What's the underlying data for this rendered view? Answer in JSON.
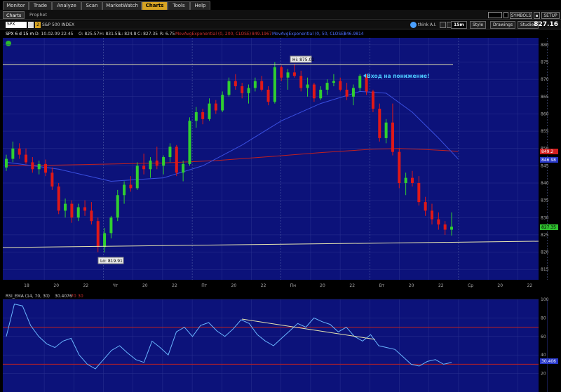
{
  "menu": {
    "tabs": [
      {
        "label": "Monitor",
        "active": false
      },
      {
        "label": "Trade",
        "active": false
      },
      {
        "label": "Analyze",
        "active": false
      },
      {
        "label": "Scan",
        "active": false
      },
      {
        "label": "MarketWatch",
        "active": false
      },
      {
        "label": "Charts",
        "active": true
      },
      {
        "label": "Tools",
        "active": false
      },
      {
        "label": "Help",
        "active": false
      }
    ]
  },
  "subtabs": {
    "charts": "Charts",
    "prophet": "Prophet"
  },
  "top_right": {
    "symbols": "SYMBOLS",
    "setup": "SETUP"
  },
  "symbol_bar": {
    "symbol": "SPX",
    "link_number": "2",
    "description": "S&P 500 INDEX",
    "thinkai": "think A.I.",
    "timeframe": "15m",
    "style": "Style",
    "drawings": "Drawings",
    "studies": "Studies",
    "last": "827.16"
  },
  "chart": {
    "header": {
      "title": "SPX 6 d 15 m",
      "date": "D: 10.02.09 22:45",
      "open": "O: 825.57",
      "high": "H: 831.55",
      "low": "L: 824.8",
      "close": "C: 827.35",
      "range": "R: 6.75",
      "ema200_label": "MovAvgExponential (0, 200, CLOSE)",
      "ema200_value": "849.1967",
      "ema50_label": "MovAvgExponential (0, 50, CLOSE)",
      "ema50_value": "846.9814"
    },
    "price_axis_ticks": [
      "880",
      "875",
      "870",
      "865",
      "860",
      "855",
      "850",
      "845",
      "840",
      "835",
      "830",
      "825",
      "820",
      "815"
    ],
    "time_axis_labels": [
      "18",
      "20",
      "22",
      "Чт",
      "20",
      "22",
      "Пт",
      "20",
      "22",
      "Пн",
      "20",
      "22",
      "Вт",
      "20",
      "22",
      "Ср",
      "20",
      "22"
    ],
    "high_label": "Hi: 875.01",
    "low_label": "Lo: 819.91",
    "annotation": "Вход на понижение!",
    "price_tags": {
      "ema200": "849.2",
      "ema50": "846.98",
      "last": "827.35"
    }
  },
  "rsi": {
    "label": "RSI_EMA (14, 70, 30)",
    "value": "30.4076",
    "overbought": "70",
    "oversold": "30",
    "axis_ticks": [
      "100",
      "80",
      "60",
      "40",
      "20"
    ],
    "value_tag": "30.406"
  },
  "chart_data": {
    "type": "candlestick",
    "symbol": "SPX",
    "interval": "15m",
    "ylim": [
      812,
      882
    ],
    "candles": [
      [
        844.5,
        848.2,
        843.5,
        847.0
      ],
      [
        847.0,
        852.0,
        846.0,
        850.0
      ],
      [
        850.0,
        851.5,
        847.0,
        848.2
      ],
      [
        848.2,
        850.0,
        845.5,
        846.0
      ],
      [
        846.0,
        847.5,
        843.0,
        844.0
      ],
      [
        844.0,
        846.5,
        842.5,
        845.5
      ],
      [
        845.5,
        846.8,
        842.0,
        843.0
      ],
      [
        843.0,
        844.5,
        838.0,
        839.0
      ],
      [
        839.0,
        840.0,
        831.0,
        832.0
      ],
      [
        832.0,
        835.5,
        830.0,
        834.0
      ],
      [
        834.0,
        835.0,
        828.5,
        830.0
      ],
      [
        830.0,
        834.0,
        829.0,
        833.0
      ],
      [
        833.0,
        835.0,
        830.5,
        832.0
      ],
      [
        832.0,
        834.5,
        828.0,
        829.0
      ],
      [
        829.0,
        830.0,
        820.0,
        821.5
      ],
      [
        821.5,
        827.0,
        819.9,
        825.5
      ],
      [
        825.5,
        830.5,
        824.0,
        830.0
      ],
      [
        830.0,
        838.0,
        829.0,
        836.5
      ],
      [
        836.5,
        840.5,
        834.0,
        839.5
      ],
      [
        839.5,
        842.0,
        837.5,
        838.5
      ],
      [
        838.5,
        846.0,
        838.0,
        845.0
      ],
      [
        845.0,
        848.5,
        842.5,
        844.0
      ],
      [
        844.0,
        847.5,
        841.5,
        846.5
      ],
      [
        846.5,
        850.5,
        844.0,
        845.0
      ],
      [
        845.0,
        848.0,
        842.5,
        847.5
      ],
      [
        847.5,
        851.5,
        846.0,
        850.5
      ],
      [
        850.5,
        851.0,
        842.0,
        843.0
      ],
      [
        843.0,
        846.5,
        840.5,
        845.5
      ],
      [
        845.5,
        859.0,
        845.0,
        858.0
      ],
      [
        858.0,
        862.0,
        856.0,
        860.5
      ],
      [
        860.5,
        861.5,
        857.0,
        858.5
      ],
      [
        858.5,
        864.5,
        858.0,
        863.0
      ],
      [
        863.0,
        864.0,
        860.0,
        861.0
      ],
      [
        861.0,
        866.5,
        860.5,
        865.5
      ],
      [
        865.5,
        870.5,
        865.0,
        869.5
      ],
      [
        869.5,
        871.5,
        867.0,
        868.0
      ],
      [
        868.0,
        869.0,
        864.5,
        866.0
      ],
      [
        866.0,
        868.5,
        863.0,
        867.5
      ],
      [
        867.5,
        870.5,
        866.5,
        869.5
      ],
      [
        869.5,
        871.0,
        866.5,
        867.0
      ],
      [
        867.0,
        868.0,
        862.5,
        863.5
      ],
      [
        863.5,
        875.0,
        863.0,
        873.5
      ],
      [
        873.5,
        874.0,
        869.5,
        870.5
      ],
      [
        870.5,
        873.0,
        867.0,
        872.0
      ],
      [
        872.0,
        874.5,
        870.5,
        871.0
      ],
      [
        871.0,
        872.5,
        866.5,
        867.5
      ],
      [
        867.5,
        870.5,
        865.0,
        868.5
      ],
      [
        868.5,
        869.0,
        863.5,
        864.5
      ],
      [
        864.5,
        868.0,
        864.0,
        867.0
      ],
      [
        867.0,
        870.0,
        865.5,
        869.0
      ],
      [
        869.0,
        871.5,
        868.0,
        869.5
      ],
      [
        869.5,
        870.5,
        866.5,
        867.0
      ],
      [
        867.0,
        869.0,
        864.0,
        865.0
      ],
      [
        865.0,
        868.5,
        862.5,
        867.5
      ],
      [
        867.5,
        871.5,
        866.5,
        871.0
      ],
      [
        871.0,
        871.5,
        865.5,
        866.5
      ],
      [
        866.5,
        867.0,
        860.5,
        861.5
      ],
      [
        861.5,
        863.0,
        852.0,
        853.0
      ],
      [
        853.0,
        858.5,
        851.5,
        857.5
      ],
      [
        857.5,
        863.0,
        848.0,
        849.0
      ],
      [
        849.0,
        850.0,
        838.5,
        840.0
      ],
      [
        840.0,
        843.0,
        836.5,
        841.5
      ],
      [
        841.5,
        843.5,
        839.0,
        840.0
      ],
      [
        840.0,
        842.0,
        833.5,
        834.5
      ],
      [
        834.5,
        836.0,
        830.5,
        832.0
      ],
      [
        832.0,
        834.0,
        828.0,
        829.5
      ],
      [
        829.5,
        831.5,
        826.5,
        828.0
      ],
      [
        828.0,
        829.0,
        825.0,
        826.5
      ],
      [
        826.5,
        831.5,
        824.8,
        827.35
      ]
    ],
    "series": [
      {
        "name": "MovAvgExponential (0, 200, CLOSE)",
        "last": 849.1967,
        "color": "#c02020"
      },
      {
        "name": "MovAvgExponential (0, 50, CLOSE)",
        "last": 846.9814,
        "color": "#3a4fe0"
      }
    ],
    "ema200_path": [
      [
        0,
        845.0
      ],
      [
        8,
        845.2
      ],
      [
        16,
        845.5
      ],
      [
        24,
        845.8
      ],
      [
        32,
        846.5
      ],
      [
        40,
        847.6
      ],
      [
        48,
        848.8
      ],
      [
        56,
        849.8
      ],
      [
        60,
        850.0
      ],
      [
        64,
        849.7
      ],
      [
        69,
        849.2
      ]
    ],
    "ema50_path": [
      [
        0,
        846.0
      ],
      [
        8,
        844.0
      ],
      [
        16,
        840.5
      ],
      [
        24,
        841.5
      ],
      [
        30,
        845.0
      ],
      [
        36,
        851.0
      ],
      [
        42,
        858.0
      ],
      [
        48,
        863.0
      ],
      [
        54,
        866.5
      ],
      [
        58,
        866.0
      ],
      [
        62,
        860.5
      ],
      [
        66,
        853.0
      ],
      [
        69,
        846.98
      ]
    ],
    "rsi_values": [
      60,
      95,
      93,
      72,
      60,
      52,
      48,
      55,
      58,
      40,
      30,
      25,
      35,
      45,
      50,
      42,
      35,
      32,
      55,
      48,
      40,
      65,
      70,
      60,
      72,
      75,
      66,
      60,
      68,
      78,
      74,
      62,
      55,
      50,
      58,
      66,
      74,
      70,
      80,
      76,
      73,
      65,
      70,
      60,
      55,
      62,
      50,
      48,
      46,
      38,
      30,
      28,
      33,
      35,
      30,
      32
    ],
    "rsi_ylim": [
      0,
      100
    ]
  }
}
